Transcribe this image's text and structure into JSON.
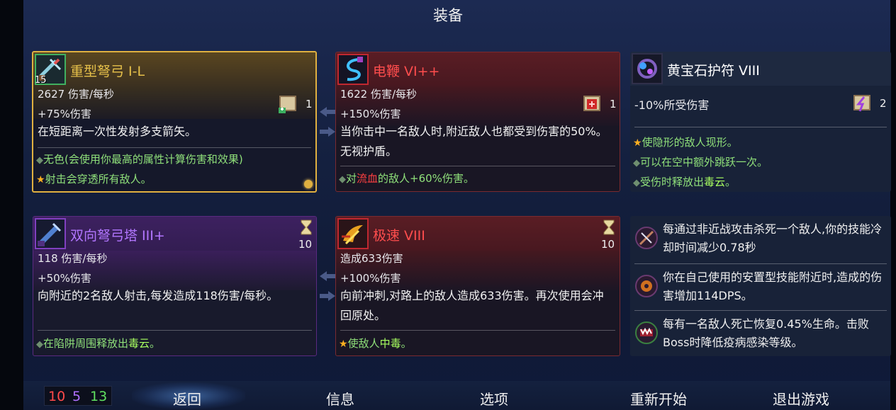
{
  "title": "装备",
  "weapons": [
    {
      "name": "重型弩弓 I-L",
      "level": "15",
      "dps": "2627 伤害/每秒",
      "bonus": "+75%伤害",
      "desc": "在短距离一次性发射多支箭矢。",
      "scroll_count": "1",
      "traits": [
        {
          "bullet": "◆",
          "text": "无色(会使用你最高的属性计算伤害和效果)"
        },
        {
          "bullet": "★",
          "text": "射击会穿透所有敌人。"
        }
      ]
    },
    {
      "name": "电鞭 VI++",
      "dps": "1622 伤害/每秒",
      "bonus": "+150%伤害",
      "desc": "当你击中一名敌人时,附近敌人也都受到伤害的50%。无视护盾。",
      "scroll_count": "1",
      "trait_pre": "对",
      "trait_hl": "流血",
      "trait_post": "的敌人+60%伤害。",
      "trait_bullet": "◆"
    },
    {
      "name": "双向弩弓塔 III+",
      "dps": "118 伤害/每秒",
      "bonus": "+50%伤害",
      "desc": "向附近的2名敌人射击,每发造成118伤害/每秒。",
      "cooldown": "10",
      "trait_bullet": "◆",
      "trait_pre": "在陷阱周围释放出",
      "trait_hl": "毒云",
      "trait_post": "。"
    },
    {
      "name": "极速 VIII",
      "dps": "造成633伤害",
      "bonus": "+100%伤害",
      "desc": "向前冲刺,对路上的敌人造成633伤害。再次使用会冲回原处。",
      "cooldown": "10",
      "trait_bullet": "★",
      "trait_pre": "使敌人",
      "trait_hl": "中毒",
      "trait_post": "。"
    }
  ],
  "amulet": {
    "name": "黄宝石护符 VIII",
    "stat": "-10%所受伤害",
    "scroll_count": "2",
    "traits": [
      {
        "bullet": "★",
        "text": "使隐形的敌人现形。"
      },
      {
        "bullet": "◆",
        "text": "可以在空中额外跳跃一次。"
      },
      {
        "bullet": "◆",
        "pre": "受伤时释放出",
        "hl": "毒云",
        "post": "。"
      }
    ]
  },
  "passives": [
    {
      "icon": "cooldown-icon",
      "text": "每通过非近战攻击杀死一个敌人,你的技能冷却时间减少0.78秒"
    },
    {
      "icon": "trap-icon",
      "text": "你在自己使用的安置型技能附近时,造成的伤害增加114DPS。"
    },
    {
      "icon": "fang-icon",
      "text": "每有一名敌人死亡恢复0.45%生命。击败Boss时降低疫病感染等级。"
    }
  ],
  "stats": {
    "red": "10",
    "purple": "5",
    "green": "13"
  },
  "nav": [
    "返回",
    "信息",
    "选项",
    "重新开始",
    "退出游戏"
  ],
  "colors": {
    "red": "#ff4a4a",
    "purple": "#b070ff",
    "green": "#60e060",
    "gold": "#d8a83c"
  }
}
